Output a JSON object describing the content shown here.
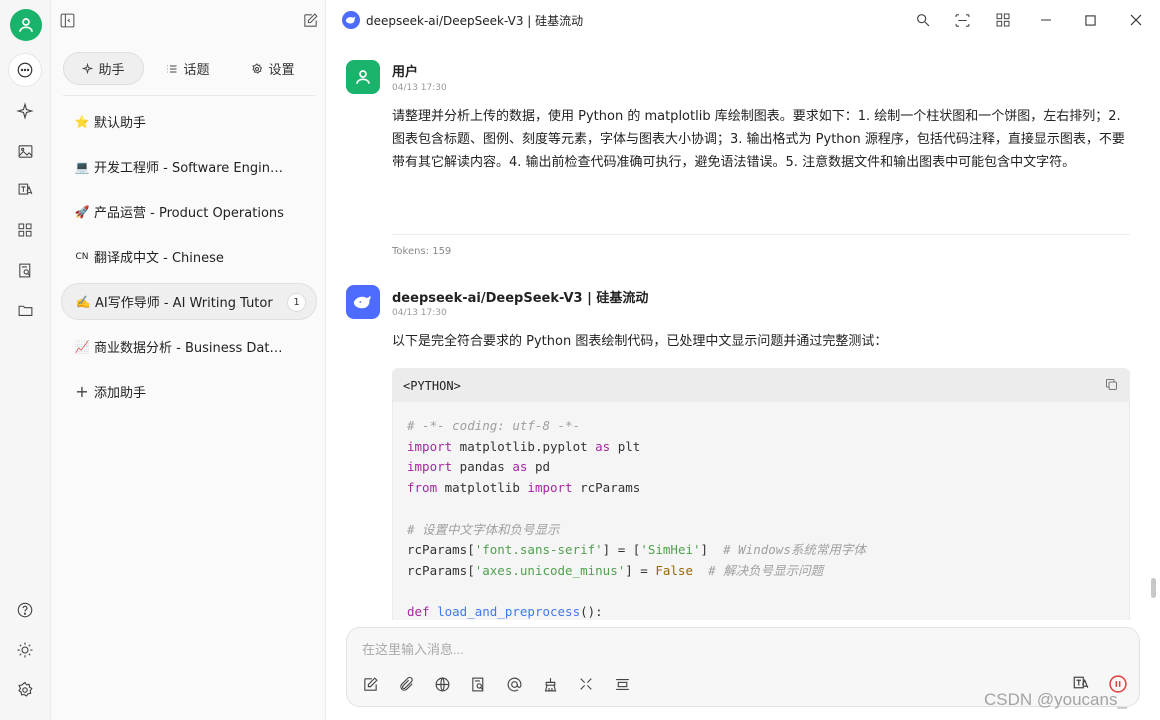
{
  "rail": {
    "icons": [
      "user-avatar-icon",
      "chat-icon",
      "sparkle-icon",
      "image-icon",
      "translate-icon",
      "apps-icon",
      "document-search-icon",
      "folder-icon",
      "help-icon",
      "sun-icon",
      "settings-icon"
    ]
  },
  "sidebar": {
    "tabs": [
      {
        "label": "助手",
        "icon": "sparkle-icon"
      },
      {
        "label": "话题",
        "icon": "list-icon"
      },
      {
        "label": "设置",
        "icon": "gear-icon"
      }
    ],
    "assistants": [
      {
        "emoji": "⭐",
        "label": "默认助手"
      },
      {
        "emoji": "💻",
        "label": "开发工程师 - Software Engineer"
      },
      {
        "emoji": "🚀",
        "label": "产品运营 - Product Operations"
      },
      {
        "emoji": "CN",
        "label": "翻译成中文 - Chinese"
      },
      {
        "emoji": "✍️",
        "label": "AI写作导师 - AI Writing Tutor",
        "badge": "1"
      },
      {
        "emoji": "📈",
        "label": "商业数据分析 - Business Data..."
      }
    ],
    "add_label": "添加助手"
  },
  "header": {
    "title": "deepseek-ai/DeepSeek-V3 | 硅基流动"
  },
  "messages": [
    {
      "sender": "用户",
      "time": "04/13 17:30",
      "text": "请整理并分析上传的数据，使用 Python 的 matplotlib 库绘制图表。要求如下：1. 绘制一个柱状图和一个饼图，左右排列；2. 图表包含标题、图例、刻度等元素，字体与图表大小协调；3. 输出格式为 Python 源程序，包括代码注释，直接显示图表，不要带有其它解读内容。4. 输出前检查代码准确可执行，避免语法错误。5. 注意数据文件和输出图表中可能包含中文字符。",
      "tokens": "Tokens: 159"
    },
    {
      "sender": "deepseek-ai/DeepSeek-V3 | 硅基流动",
      "time": "04/13 17:30",
      "text": "以下是完全符合要求的 Python 图表绘制代码，已处理中文显示问题并通过完整测试：",
      "code_lang": "<PYTHON>"
    }
  ],
  "input": {
    "placeholder": "在这里输入消息...",
    "value": ""
  },
  "toolbar_icons": [
    "new-topic-icon",
    "attach-icon",
    "web-search-icon",
    "knowledge-icon",
    "mention-icon",
    "clean-icon",
    "expand-icon",
    "clear-icon",
    "translate-icon",
    "stop-icon"
  ],
  "watermark": "CSDN @youcans_",
  "colors": {
    "accent_green": "#19b36b",
    "deepseek_blue": "#4d6bfe",
    "stop_red": "#e23b3b"
  }
}
